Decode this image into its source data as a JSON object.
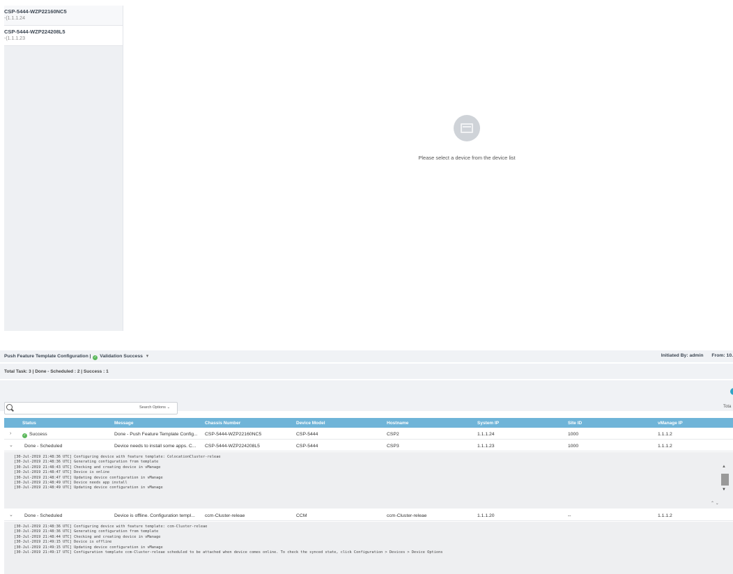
{
  "device_list": {
    "items": [
      {
        "name": "CSP-5444-WZP22160NC5",
        "ip": "-(1.1.1.24"
      },
      {
        "name": "CSP-5444-WZP224208L5",
        "ip": "-(1.1.1.23"
      }
    ]
  },
  "empty_state": {
    "message": "Please select a device from the device list"
  },
  "task": {
    "title": "Push Feature Template Configuration",
    "separator": "|",
    "validation": "Validation Success",
    "caret": "▾",
    "initiated_by": "Initiated By: admin",
    "from": "From: 10.",
    "summary": "Total Task: 3 | Done - Scheduled : 2 | Success : 1",
    "total_label": "Tota"
  },
  "search": {
    "placeholder": "",
    "options_label": "Search Options",
    "options_caret": "⌄"
  },
  "table": {
    "columns": [
      "Status",
      "Message",
      "Chassis Number",
      "Device Model",
      "Hostname",
      "System IP",
      "Site ID",
      "vManage IP"
    ],
    "rows": [
      {
        "chevron": "›",
        "status": "Success",
        "message": "Done - Push Feature Template Config...",
        "chassis": "CSP-5444-WZP22160NC5",
        "model": "CSP-5444",
        "hostname": "CSP2",
        "system_ip": "1.1.1.24",
        "site_id": "1000",
        "vmanage_ip": "1.1.1.2"
      },
      {
        "chevron": "⌄",
        "status": "Done - Scheduled",
        "message": "Device needs to install some apps. C...",
        "chassis": "CSP-5444-WZP224208L5",
        "model": "CSP-5444",
        "hostname": "CSP3",
        "system_ip": "1.1.1.23",
        "site_id": "1000",
        "vmanage_ip": "1.1.1.2"
      },
      {
        "chevron": "⌄",
        "status": "Done - Scheduled",
        "message": "Device is offline. Configuration templ...",
        "chassis": "ccm-Cluster-releae",
        "model": "CCM",
        "hostname": "ccm-Cluster-releae",
        "system_ip": "1.1.1.20",
        "site_id": "--",
        "vmanage_ip": "1.1.1.2"
      }
    ],
    "log1": "[30-Jul-2019 21:48:36 UTC] Configuring device with feature template: ColocationCluster-releae\n[30-Jul-2019 21:48:36 UTC] Generating configuration from template\n[30-Jul-2019 21:48:43 UTC] Checking and creating device in vManage\n[30-Jul-2019 21:48:47 UTC] Device is online\n[30-Jul-2019 21:48:47 UTC] Updating device configuration in vManage\n[30-Jul-2019 21:48:49 UTC] Device needs app install\n[30-Jul-2019 21:48:49 UTC] Updating device configuration in vManage",
    "log2": "[30-Jul-2019 21:48:36 UTC] Configuring device with feature template: ccm-Cluster-releae\n[30-Jul-2019 21:48:36 UTC] Generating configuration from template\n[30-Jul-2019 21:48:44 UTC] Checking and creating device in vManage\n[30-Jul-2019 21:49:15 UTC] Device is offline\n[30-Jul-2019 21:49:15 UTC] Updating device configuration in vManage\n[30-Jul-2019 21:49:17 UTC] Configuration template ccm-Cluster-releae scheduled to be attached when device comes online. To check the synced state, click Configuration > Devices > Device Options"
  },
  "scroll": {
    "up": "▲",
    "down": "▼",
    "arrows": "⌃ ⌄"
  }
}
